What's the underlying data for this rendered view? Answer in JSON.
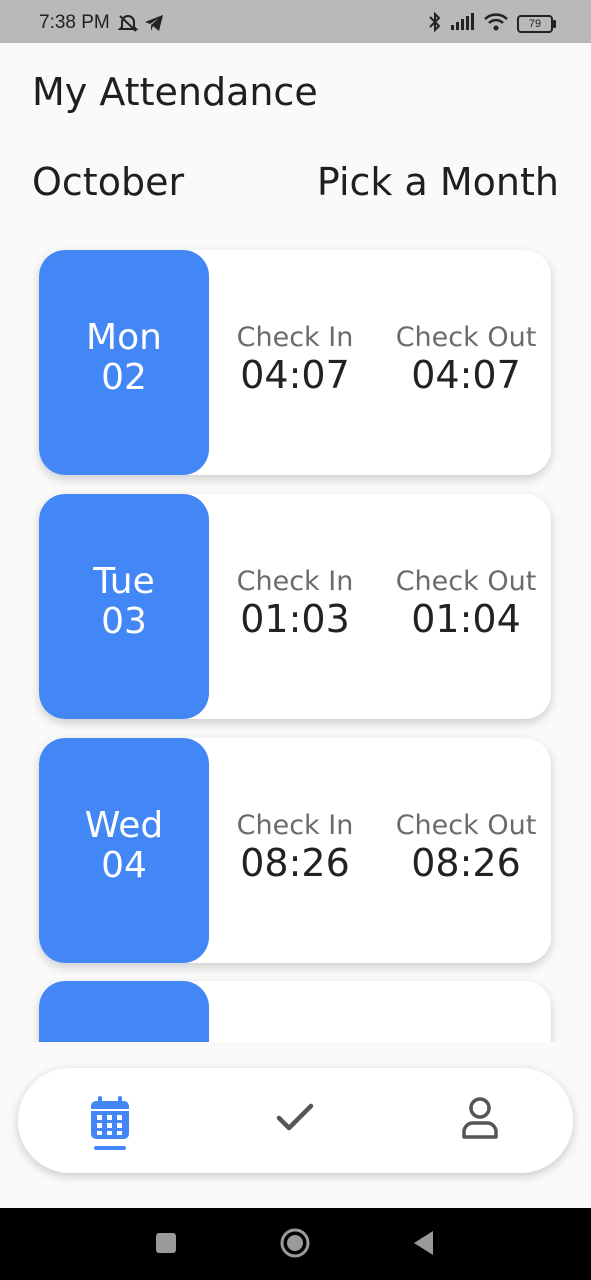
{
  "status_bar": {
    "time": "7:38 PM",
    "battery": "79"
  },
  "header": {
    "title": "My Attendance",
    "month": "October",
    "pick_month": "Pick a Month"
  },
  "labels": {
    "check_in": "Check In",
    "check_out": "Check Out"
  },
  "attendance": [
    {
      "day": "Mon",
      "date": "02",
      "check_in": "04:07",
      "check_out": "04:07"
    },
    {
      "day": "Tue",
      "date": "03",
      "check_in": "01:03",
      "check_out": "01:04"
    },
    {
      "day": "Wed",
      "date": "04",
      "check_in": "08:26",
      "check_out": "08:26"
    }
  ],
  "colors": {
    "accent": "#4287f5",
    "text": "#222222",
    "muted": "#6b6b6b"
  },
  "nav": {
    "items": [
      "calendar-icon",
      "check-icon",
      "person-icon"
    ],
    "active": "calendar-icon"
  }
}
